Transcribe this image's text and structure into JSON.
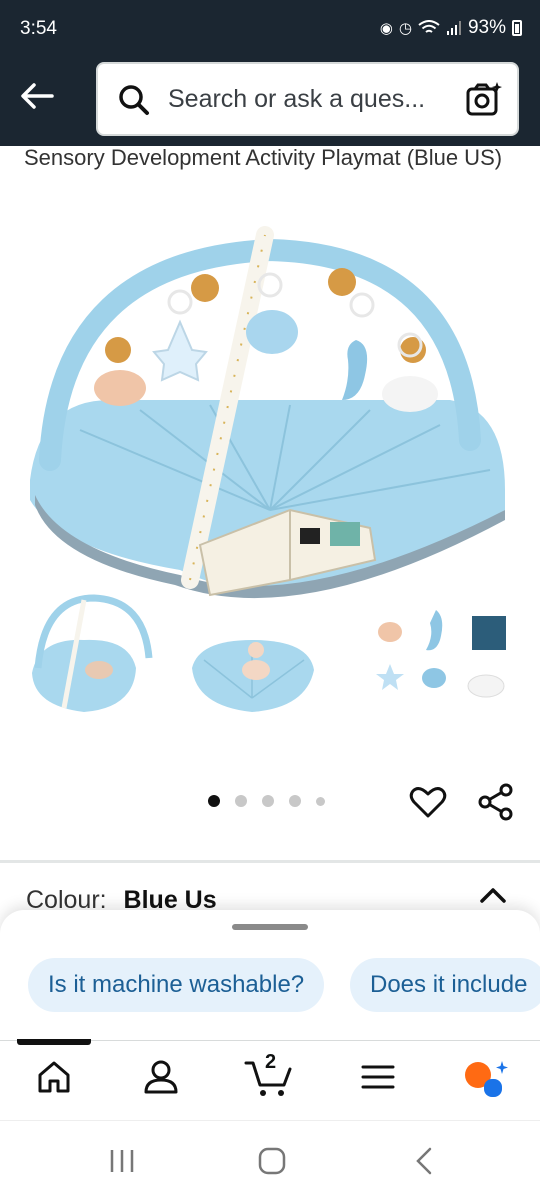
{
  "status_bar": {
    "time": "3:54",
    "battery": "93%"
  },
  "header": {
    "search_placeholder": "Search or ask a ques...",
    "colors": {
      "background": "#1b2631"
    }
  },
  "product": {
    "title": "Sensory Development Activity Playmat (Blue US)",
    "image_pager": {
      "count": 5,
      "active_index": 0
    }
  },
  "colour_selector": {
    "label": "Colour:",
    "value": "Blue Us"
  },
  "suggestions": [
    "Is it machine washable?",
    "Does it include"
  ],
  "bottom_nav": {
    "cart_count": "2",
    "items": [
      "home-icon",
      "account-icon",
      "cart-icon",
      "menu-icon",
      "rufus-icon"
    ]
  },
  "system_nav": [
    "recents-icon",
    "home-circle-icon",
    "back-chevron-icon"
  ]
}
